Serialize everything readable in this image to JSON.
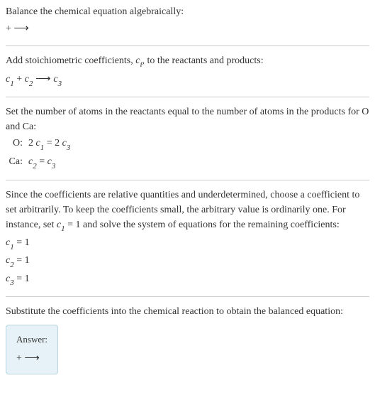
{
  "section1": {
    "title": "Balance the chemical equation algebraically:",
    "reaction": " +  ⟶ "
  },
  "section2": {
    "title": "Add stoichiometric coefficients, ",
    "coeff_var": "c",
    "coeff_sub": "i",
    "title_after": ", to the reactants and products:",
    "eq_c1": "c",
    "eq_c1_sub": "1",
    "eq_plus": " + ",
    "eq_c2": "c",
    "eq_c2_sub": "2",
    "eq_arrow": " ⟶ ",
    "eq_c3": "c",
    "eq_c3_sub": "3"
  },
  "section3": {
    "title": "Set the number of atoms in the reactants equal to the number of atoms in the products for O and Ca:",
    "rows": [
      {
        "label": "O:",
        "lhs_coeff": "2 ",
        "lhs_c": "c",
        "lhs_sub": "1",
        "eq": " = ",
        "rhs_coeff": "2 ",
        "rhs_c": "c",
        "rhs_sub": "3"
      },
      {
        "label": "Ca:",
        "lhs_coeff": "",
        "lhs_c": "c",
        "lhs_sub": "2",
        "eq": " = ",
        "rhs_coeff": "",
        "rhs_c": "c",
        "rhs_sub": "3"
      }
    ]
  },
  "section4": {
    "text_before": "Since the coefficients are relative quantities and underdetermined, choose a coefficient to set arbitrarily. To keep the coefficients small, the arbitrary value is ordinarily one. For instance, set ",
    "set_c": "c",
    "set_sub": "1",
    "set_val": " = 1",
    "text_after": " and solve the system of equations for the remaining coefficients:",
    "solutions": [
      {
        "c": "c",
        "sub": "1",
        "val": " = 1"
      },
      {
        "c": "c",
        "sub": "2",
        "val": " = 1"
      },
      {
        "c": "c",
        "sub": "3",
        "val": " = 1"
      }
    ]
  },
  "section5": {
    "title": "Substitute the coefficients into the chemical reaction to obtain the balanced equation:"
  },
  "answer": {
    "label": "Answer:",
    "content": " +  ⟶ "
  }
}
